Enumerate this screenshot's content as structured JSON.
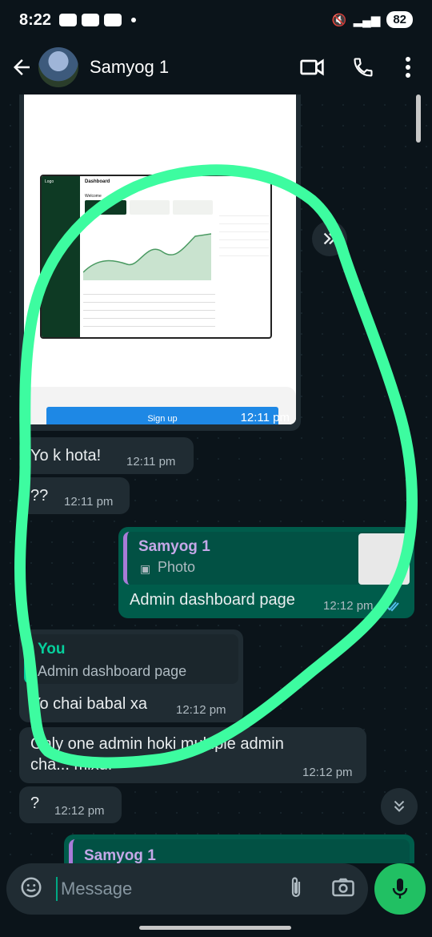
{
  "status_bar": {
    "time": "8:22",
    "battery": "82"
  },
  "header": {
    "contact_name": "Samyog 1"
  },
  "image_message": {
    "time": "12:11 pm",
    "preview": {
      "title": "Dashboard",
      "logo": "Logo",
      "welcome": "Welcome",
      "signup_label": "Sign up"
    }
  },
  "messages": [
    {
      "id": "m1",
      "text": "Yo k hota!",
      "time": "12:11 pm",
      "direction": "in"
    },
    {
      "id": "m2",
      "text": "??",
      "time": "12:11 pm",
      "direction": "in"
    },
    {
      "id": "m3",
      "text": "Admin dashboard page",
      "time": "12:12 pm",
      "direction": "out",
      "reply_to": {
        "name": "Samyog 1",
        "text": "Photo"
      }
    },
    {
      "id": "m4",
      "text": "Yo chai babal xa",
      "time": "12:12 pm",
      "direction": "in",
      "reply_to": {
        "name": "You",
        "text": "Admin dashboard page"
      }
    },
    {
      "id": "m5",
      "text": "Only one admin hoki multiple admin",
      "line2": "cha... mixu.",
      "time": "12:12 pm",
      "direction": "in"
    },
    {
      "id": "m6",
      "text": "?",
      "time": "12:12 pm",
      "direction": "in"
    },
    {
      "id": "m7",
      "reply_name": "Samyog 1",
      "direction": "out"
    }
  ],
  "input": {
    "placeholder": "Message"
  },
  "colors": {
    "accent": "#21c063",
    "outgoing": "#005c4b",
    "incoming": "#202c33",
    "annotation": "#3dfca0"
  },
  "icons": [
    "back-arrow-icon",
    "video-call-icon",
    "phone-icon",
    "more-vert-icon",
    "forward-icon",
    "sticker-icon",
    "attach-icon",
    "camera-icon",
    "mic-icon",
    "scroll-down-icon",
    "read-receipt-icon",
    "photo-icon"
  ]
}
